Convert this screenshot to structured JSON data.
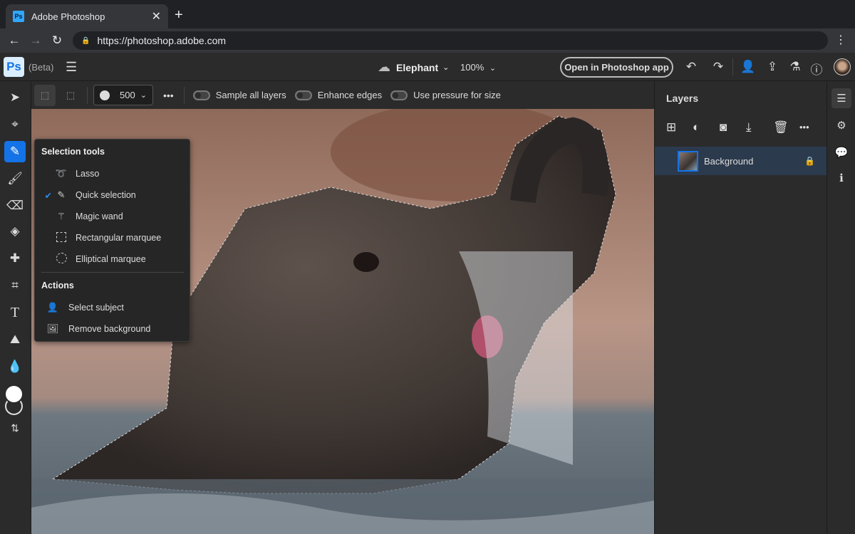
{
  "browser": {
    "tab_title": "Adobe Photoshop",
    "url": "https://photoshop.adobe.com"
  },
  "app": {
    "logo": "Ps",
    "beta_label": "(Beta)",
    "doc_name": "Elephant",
    "zoom": "100%",
    "open_app_label": "Open in Photoshop app"
  },
  "options": {
    "brush_size": "500",
    "sample_all_layers": "Sample all layers",
    "enhance_edges": "Enhance edges",
    "use_pressure": "Use pressure for size",
    "toggles": {
      "sample_all_layers": false,
      "enhance_edges": false,
      "use_pressure": false
    }
  },
  "popup": {
    "section1": "Selection tools",
    "tools": [
      {
        "label": "Lasso",
        "selected": false
      },
      {
        "label": "Quick selection",
        "selected": true
      },
      {
        "label": "Magic wand",
        "selected": false
      },
      {
        "label": "Rectangular marquee",
        "selected": false
      },
      {
        "label": "Elliptical marquee",
        "selected": false
      }
    ],
    "section2": "Actions",
    "actions": [
      {
        "label": "Select subject"
      },
      {
        "label": "Remove background"
      }
    ]
  },
  "layers": {
    "title": "Layers",
    "items": [
      {
        "name": "Background",
        "locked": true
      }
    ]
  },
  "colors": {
    "accent": "#1473e6",
    "panel": "#2b2b2b",
    "selected_layer": "#2c3a4d"
  }
}
